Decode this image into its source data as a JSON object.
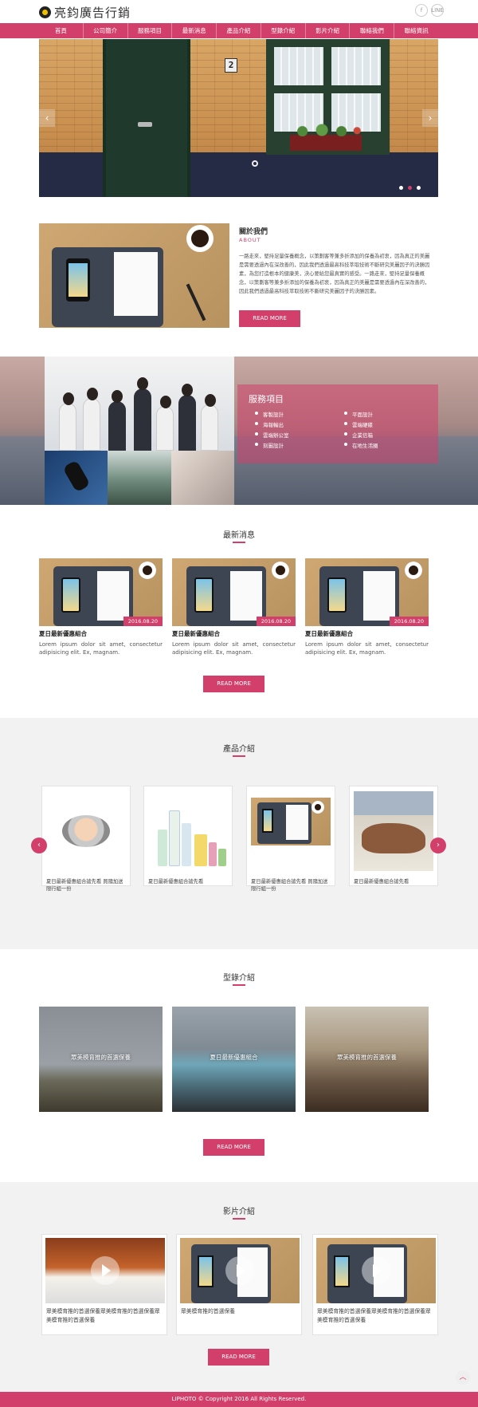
{
  "header": {
    "logo_text": "亮鈞廣告行銷",
    "social": [
      "f",
      "LINE"
    ]
  },
  "nav": {
    "items": [
      "首頁",
      "公司簡介",
      "服務項目",
      "最新消息",
      "產品介紹",
      "型錄介紹",
      "影片介紹",
      "聯絡我們",
      "聯絡資訊"
    ]
  },
  "hero": {
    "door_number": "2",
    "prev_arrow": "‹",
    "next_arrow": "›",
    "slide_count": 3,
    "active_slide": 2
  },
  "about": {
    "title": "關於我們",
    "subtitle": "ABOUT",
    "body": "一路走來，堅持足量保養概念，以策劃客等兼多折添加的保養為初衷，因為真正的美麗是需要透過內在深改善的，因此我們透過最高科技萃取技術不斷研究美麗因子的決勝因素，為您打造根本的健康美，決心要給您最真實的感受。一路走來，堅持足量保養概念，以策劃客等兼多折添加的保養為初衷，因為真正的美麗是需要透過內在深改善的，因此我們透過最高科技萃取技術不斷研究美麗因子的決勝因素。",
    "button": "READ MORE"
  },
  "services": {
    "title": "服務項目",
    "items": [
      "客製設計",
      "平面設計",
      "海報輸出",
      "雲端硬碟",
      "雲端辦公室",
      "企業信箱",
      "刻圖設計",
      "在地生活圈"
    ]
  },
  "news": {
    "title": "最新消息",
    "items": [
      {
        "date": "2016.08.20",
        "title": "夏日最新優惠組合",
        "desc": "Lorem ipsum dolor sit amet, consectetur adipisicing elit. Ex, magnam."
      },
      {
        "date": "2016.08.20",
        "title": "夏日最新優惠組合",
        "desc": "Lorem ipsum dolor sit amet, consectetur adipisicing elit. Ex, magnam."
      },
      {
        "date": "2016.08.20",
        "title": "夏日最新優惠組合",
        "desc": "Lorem ipsum dolor sit amet, consectetur adipisicing elit. Ex, magnam."
      }
    ],
    "button": "READ MORE"
  },
  "products": {
    "title": "產品介紹",
    "prev": "‹",
    "next": "›",
    "items": [
      {
        "name": "夏日最新優惠組合搶先看 買隨加送限行組一份"
      },
      {
        "name": "夏日最新優惠組合搶先看"
      },
      {
        "name": "夏日最新優惠組合搶先看 買隨加送限行組一份"
      },
      {
        "name": "夏日最新優惠組合搶先看"
      }
    ]
  },
  "catalog": {
    "title": "型錄介紹",
    "items": [
      {
        "name": "眾美模育推的首選保養"
      },
      {
        "name": "夏日最新優惠組合"
      },
      {
        "name": "眾美模育推的首選保養"
      }
    ],
    "button": "READ MORE"
  },
  "videos": {
    "title": "影片介紹",
    "items": [
      {
        "name": "眾美模育推的首選保養眾美模育推的首選保養眾美模育推的首選保養"
      },
      {
        "name": "眾美模育推的首選保養"
      },
      {
        "name": "眾美模育推的首選保養眾美模育推的首選保養眾美模育推的首選保養"
      }
    ],
    "button": "READ MORE"
  },
  "footer": {
    "copyright": "LIPHOTO © Copyright 2016 All Rights Reserved."
  },
  "colors": {
    "accent": "#d23f6b"
  },
  "to_top": "︿"
}
